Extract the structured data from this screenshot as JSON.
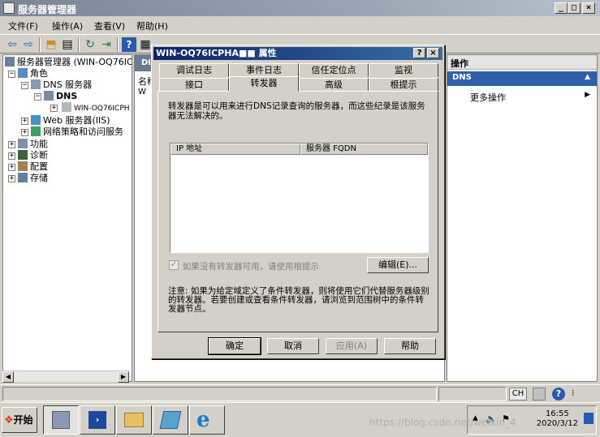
{
  "window": {
    "title": "服务器管理器"
  },
  "menu": [
    "文件(F)",
    "操作(A)",
    "查看(V)",
    "帮助(H)"
  ],
  "tree": {
    "root": "服务器管理器 (WIN-OQ76ICI",
    "roles": "角色",
    "dns_server": "DNS 服务器",
    "dns": "DNS",
    "host": "WIN-OQ76ICPH",
    "web_server": "Web 服务器(IIS)",
    "network_policy": "网络策略和访问服务",
    "features": "功能",
    "diagnostics": "诊断",
    "configuration": "配置",
    "storage": "存储"
  },
  "middle": {
    "header_fragment": "DI",
    "column_fragment": "名称",
    "row_fragment": "W"
  },
  "actions": {
    "title": "操作",
    "selected": "DNS",
    "more": "更多操作"
  },
  "dialog": {
    "title": "WIN-OQ76ICPHA■■ 属性",
    "tabs_row1": [
      "调试日志",
      "事件日志",
      "信任定位点",
      "监视"
    ],
    "tabs_row2": [
      "接口",
      "转发器",
      "高级",
      "根提示"
    ],
    "selected_tab": "转发器",
    "description": "转发器是可以用来进行DNS记录查询的服务器，而这些纪录是该服务器无法解决的。",
    "columns": [
      "IP 地址",
      "服务器 FQDN"
    ],
    "checkbox_label": "如果没有转发器可用，请使用根提示",
    "checkbox_checked": true,
    "edit_button": "编辑(E)...",
    "note": "注意: 如果为给定域定义了条件转发器，则将使用它们代替服务器级别的转发器。若要创建或查看条件转发器，请浏览到范围树中的条件转发器节点。",
    "buttons": {
      "ok": "确定",
      "cancel": "取消",
      "apply": "应用(A)",
      "help": "帮助"
    }
  },
  "statusbar": {
    "lang": "CH"
  },
  "taskbar": {
    "start": "开始",
    "time": "16:55",
    "date": "2020/3/12"
  },
  "watermark": "https://blog.csdn.net/weixin_4"
}
